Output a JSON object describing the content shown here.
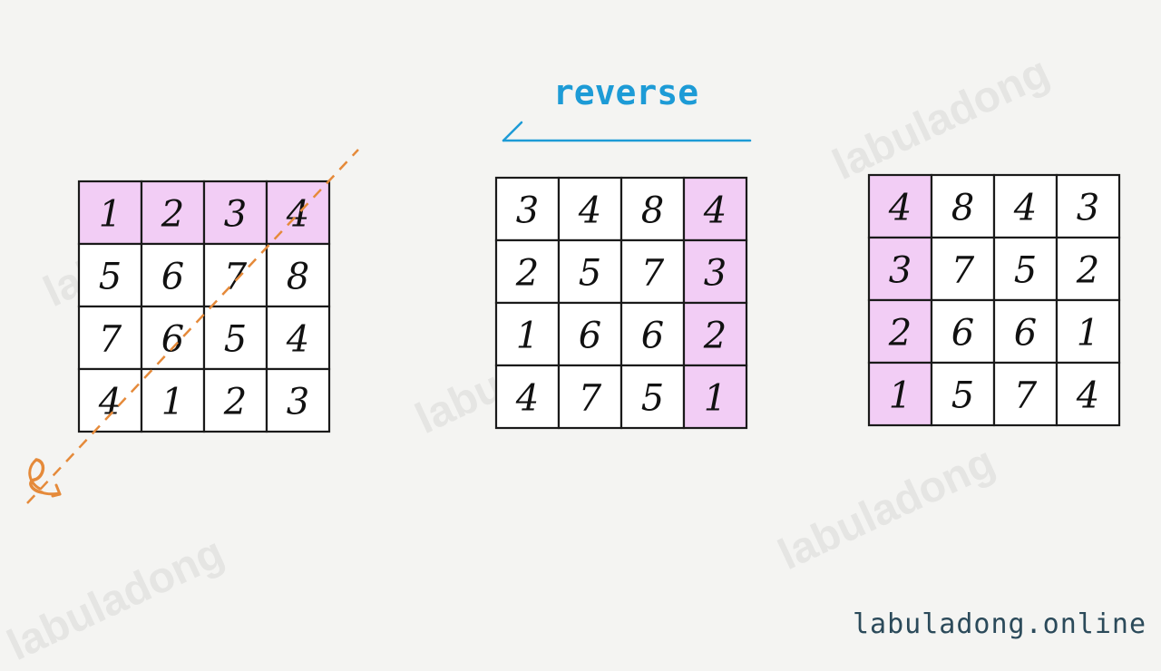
{
  "labels": {
    "reverse": "reverse",
    "site": "labuladong.online",
    "watermark": "labuladong"
  },
  "colors": {
    "highlight": "#f2cdf5",
    "grid_line": "#1a1a1a",
    "digit": "#111111",
    "reverse_label": "#1d9bd6",
    "reverse_arrow": "#1d9bd6",
    "diagonal": "#e58a3a",
    "background": "#f4f4f2"
  },
  "icons": {
    "rotate_symbol": "rotate-arrow-icon"
  },
  "grids": [
    {
      "name": "grid-original",
      "cells": [
        [
          1,
          2,
          3,
          4
        ],
        [
          5,
          6,
          7,
          8
        ],
        [
          7,
          6,
          5,
          4
        ],
        [
          4,
          1,
          2,
          3
        ]
      ],
      "highlight": "top-row",
      "diagonal": true
    },
    {
      "name": "grid-transposed",
      "cells": [
        [
          3,
          4,
          8,
          4
        ],
        [
          2,
          5,
          7,
          3
        ],
        [
          1,
          6,
          6,
          2
        ],
        [
          4,
          7,
          5,
          1
        ]
      ],
      "highlight": "right-column",
      "diagonal": false
    },
    {
      "name": "grid-reversed",
      "cells": [
        [
          4,
          8,
          4,
          3
        ],
        [
          3,
          7,
          5,
          2
        ],
        [
          2,
          6,
          6,
          1
        ],
        [
          1,
          5,
          7,
          4
        ]
      ],
      "highlight": "left-column",
      "diagonal": false
    }
  ]
}
